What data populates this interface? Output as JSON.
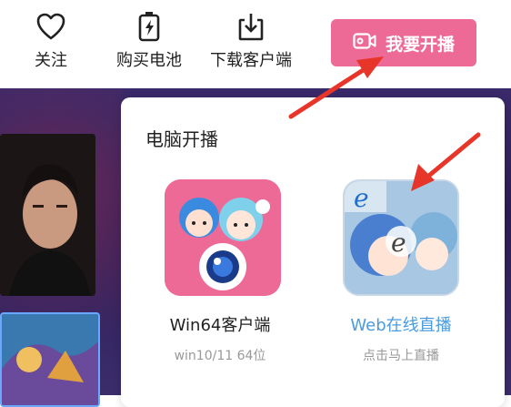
{
  "topbar": {
    "follow_label": "关注",
    "recharge_label": "购买电池",
    "download_label": "下载客户端",
    "go_live_label": "我要开播"
  },
  "popup": {
    "title": "电脑开播",
    "apps": [
      {
        "name": "Win64客户端",
        "sub": "win10/11 64位"
      },
      {
        "name": "Web在线直播",
        "sub": "点击马上直播"
      }
    ]
  },
  "colors": {
    "accent_pink": "#ee6a96",
    "web_link_blue": "#4a9be0",
    "annotation_red": "#e8352a"
  }
}
